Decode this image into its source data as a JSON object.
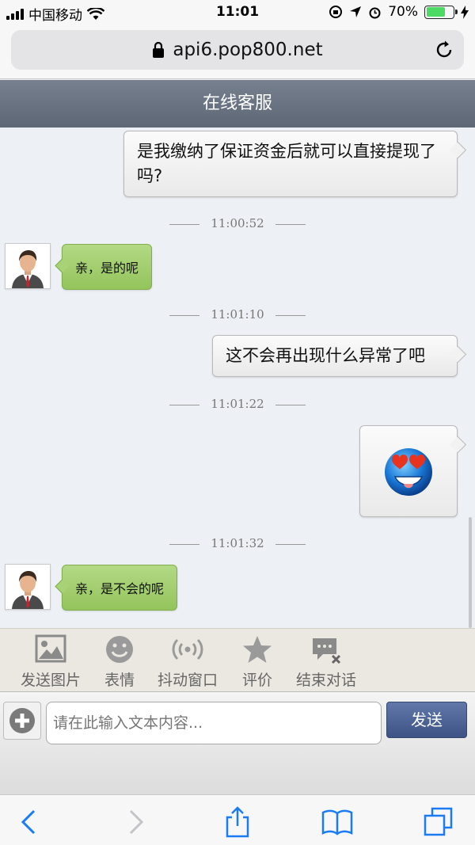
{
  "status_bar": {
    "carrier": "中国移动",
    "time": "11:01",
    "battery": "70%"
  },
  "browser": {
    "url": "api6.pop800.net"
  },
  "chat": {
    "title": "在线客服",
    "messages": [
      {
        "text": "是我缴纳了保证资金后就可以直接提现了吗?"
      },
      {
        "timestamp": "11:00:52"
      },
      {
        "text": "亲，是的呢"
      },
      {
        "timestamp": "11:01:10"
      },
      {
        "text": "这不会再出现什么异常了吧"
      },
      {
        "timestamp": "11:01:22"
      },
      {
        "emoji": "heart-eyes-emoji"
      },
      {
        "timestamp": "11:01:32"
      },
      {
        "text": "亲，是不会的呢"
      }
    ]
  },
  "toolbar": {
    "send_image": "发送图片",
    "emoji": "表情",
    "shake_window": "抖动窗口",
    "rate": "评价",
    "end_chat": "结束对话"
  },
  "composer": {
    "placeholder": "请在此输入文本内容...",
    "send_label": "发送"
  },
  "colors": {
    "header_bg": "#67717f",
    "agent_bubble": "#a3cf6f",
    "send_button": "#4a6196",
    "link_blue": "#1a7cf5"
  }
}
